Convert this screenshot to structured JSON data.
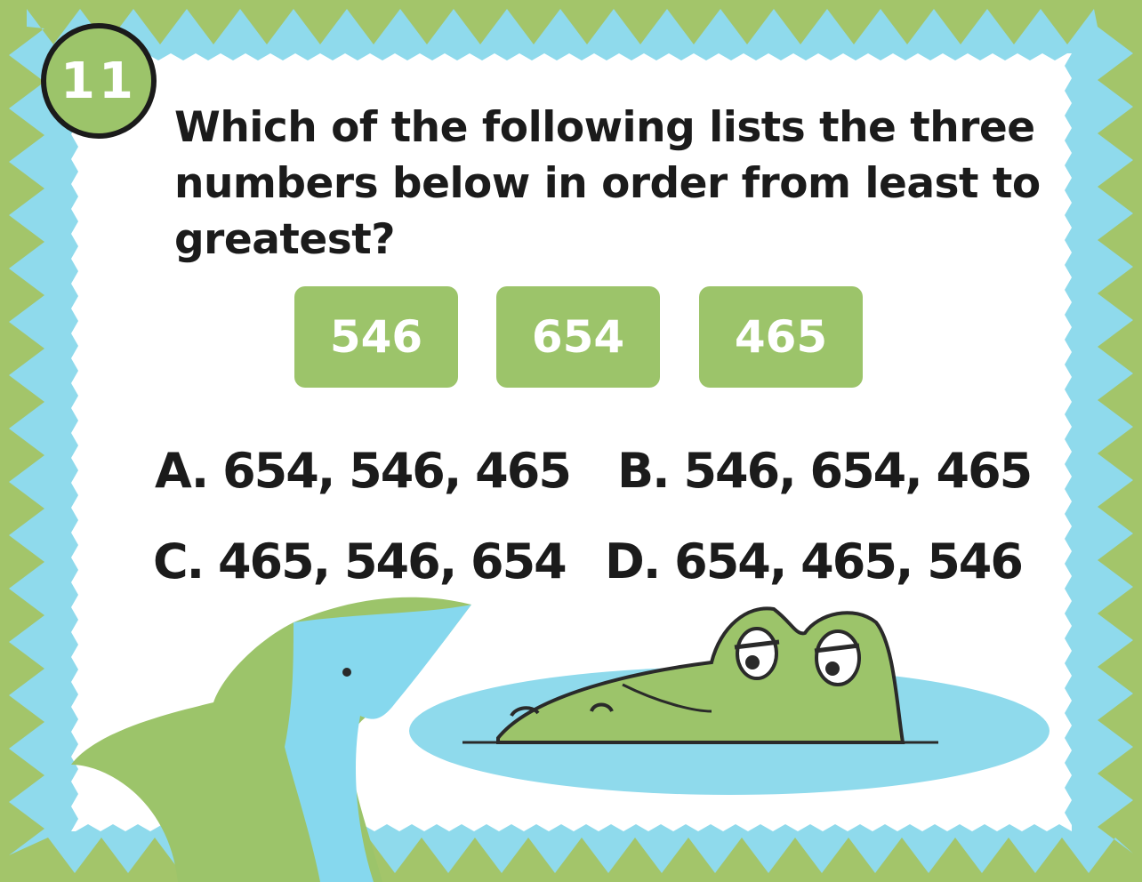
{
  "card": {
    "question_number": "11",
    "question": "Which of the following lists the three numbers below in order from least to greatest?",
    "numbers": [
      "546",
      "654",
      "465"
    ],
    "choices": {
      "a": "A. 654, 546, 465",
      "b": "B. 546, 654, 465",
      "c": "C. 465, 546, 654",
      "d": "D. 654, 465, 546"
    }
  },
  "colors": {
    "border_green": "#a3c56a",
    "border_blue": "#8fdaec",
    "card_white": "#ffffff",
    "box_green": "#9cc46a",
    "text_dark": "#1b1b1b",
    "shark_green": "#9cc46a",
    "shark_blue": "#86d8ee",
    "water_blue": "#8fdaec"
  },
  "illustrations": [
    "shark-illustration",
    "crocodile-illustration"
  ]
}
